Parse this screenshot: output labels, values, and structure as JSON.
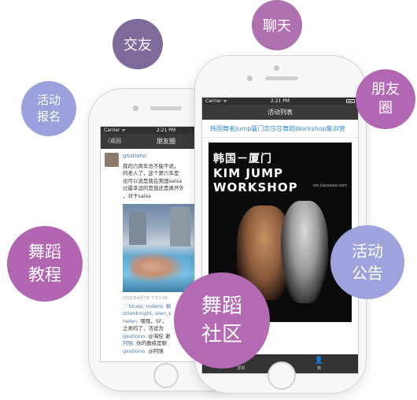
{
  "colors": {
    "bubble_purple": "#b266b1",
    "bubble_dark_purple": "#7e6a9b",
    "bubble_lavender": "#9ea3dd",
    "link_blue": "#3b8fd0",
    "navbar_dark": "#3a3a3a"
  },
  "bubbles": {
    "jiaoyou": "交友",
    "liaotian": "聊天",
    "huodong_baoming": "活动\n报名",
    "pengyouquan": "朋友\n圈",
    "wudao_jiaocheng": "舞蹈\n教程",
    "huodong_gonggao": "活动\n公告",
    "wudao_shequ": "舞蹈\n社区"
  },
  "back_phone": {
    "status": {
      "carrier": "Carrier ᯤ",
      "time": "2:21 PM"
    },
    "nav": {
      "back_label": "〈返回",
      "title": "朋友圈"
    },
    "post": {
      "username": "gsutiono",
      "text": "我的六周年总不能不说，\n的老人了，这个第六年是\n也可以说是我在美国salsa\n过最幸运的是我还是离开外\n，对于salsa",
      "timestamp": "2015年4月7日 下午2:26",
      "likes": "♡ blues, rodent, 枫\notionknight, elen_s",
      "comments": [
        {
          "who": "helen:",
          "text": " 嘿嘿，SF，"
        },
        {
          "who": "",
          "text": "之类的了，活说为"
        },
        {
          "who": "gsutiono:",
          "text": " @海伦 谢"
        },
        {
          "who": "阿强:",
          "text": " 你的教练是聊"
        },
        {
          "who": "gsutiono:",
          "text": " @阿强"
        }
      ]
    }
  },
  "front_phone": {
    "status": {
      "carrier": "Carrier ᯤ",
      "time": "2:21 PM"
    },
    "nav": {
      "title": "活动列表"
    },
    "article": {
      "title": "韩国舞者Jump厦门恋莎莎舞蹈Workshop集训营",
      "poster": {
        "headline": "韩国－厦门",
        "line1": "KIM JUMP",
        "line2": "WORKSHOP",
        "site": "xm.liansalsa.com"
      }
    },
    "tabs": [
      {
        "icon": "◎",
        "label": "发现"
      },
      {
        "icon": "👤",
        "label": "我"
      }
    ]
  }
}
